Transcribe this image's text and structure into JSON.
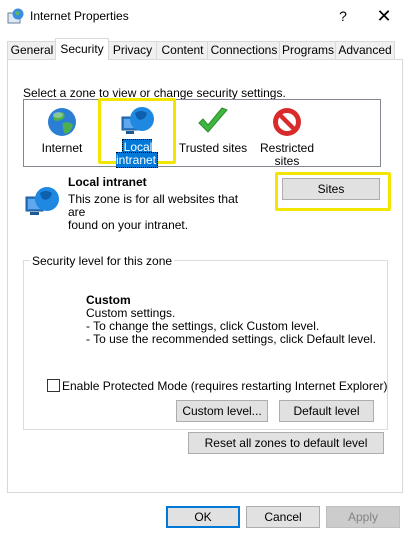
{
  "window": {
    "title": "Internet Properties",
    "help_label": "?",
    "close_label": "✕"
  },
  "tabs": [
    "General",
    "Security",
    "Privacy",
    "Content",
    "Connections",
    "Programs",
    "Advanced"
  ],
  "active_tab": "Security",
  "zones": {
    "prompt": "Select a zone to view or change security settings.",
    "items": [
      {
        "label": "Internet",
        "icon": "globe-icon"
      },
      {
        "label": "Local intranet",
        "icon": "intranet-globe-icon",
        "selected": true
      },
      {
        "label": "Trusted sites",
        "icon": "checkmark-icon"
      },
      {
        "label": "Restricted sites",
        "label_line1": "Restricted",
        "label_line2": "sites",
        "icon": "no-entry-icon"
      }
    ]
  },
  "zone_info": {
    "title": "Local intranet",
    "description_line1": "This zone is for all websites that are",
    "description_line2": "found on your intranet.",
    "sites_button": "Sites"
  },
  "security_level": {
    "group_title": "Security level for this zone",
    "level_title": "Custom",
    "lines": [
      "Custom settings.",
      "- To change the settings, click Custom level.",
      "- To use the recommended settings, click Default level."
    ],
    "protected_mode_label": "Enable Protected Mode (requires restarting Internet Explorer)",
    "protected_mode_checked": false,
    "custom_level_button": "Custom level...",
    "default_level_button": "Default level"
  },
  "reset_button": "Reset all zones to default level",
  "footer": {
    "ok": "OK",
    "cancel": "Cancel",
    "apply": "Apply"
  },
  "colors": {
    "highlight": "#f2e600",
    "selection": "#0078d7"
  }
}
